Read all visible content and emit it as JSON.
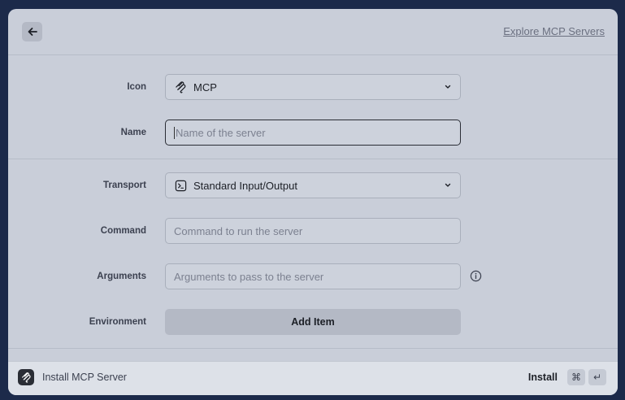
{
  "header": {
    "back_icon": "arrow-left-icon",
    "explore_link": "Explore MCP Servers"
  },
  "form": {
    "icon": {
      "label": "Icon",
      "value": "MCP",
      "icon": "mcp-logo-icon"
    },
    "name": {
      "label": "Name",
      "value": "",
      "placeholder": "Name of the server"
    },
    "transport": {
      "label": "Transport",
      "value": "Standard Input/Output",
      "icon": "terminal-icon"
    },
    "command": {
      "label": "Command",
      "value": "",
      "placeholder": "Command to run the server"
    },
    "arguments": {
      "label": "Arguments",
      "value": "",
      "placeholder": "Arguments to pass to the server"
    },
    "environment": {
      "label": "Environment",
      "button_label": "Add Item"
    }
  },
  "footer": {
    "title": "Install MCP Server",
    "action_label": "Install",
    "shortcut_keys": [
      "⌘",
      "↵"
    ]
  },
  "colors": {
    "background": "#1c2a4a",
    "panel": "#c9ced9",
    "footer": "#dde1e8",
    "button": "#b4b9c5"
  }
}
